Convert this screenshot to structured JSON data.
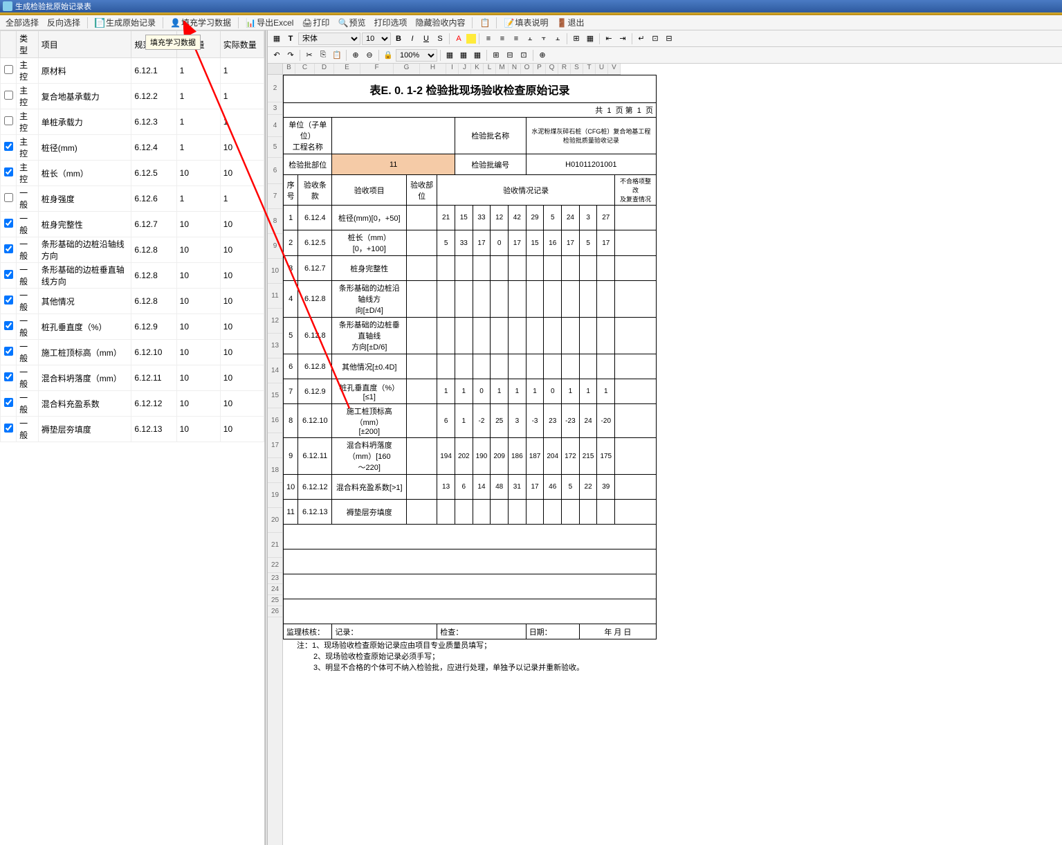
{
  "window": {
    "title": "生成检验批原始记录表"
  },
  "toolbar": {
    "select_all": "全部选择",
    "reverse_select": "反向选择",
    "gen_origin": "生成原始记录",
    "fill_learn": "填充学习数据",
    "export_excel": "导出Excel",
    "print": "打印",
    "preview": "预览",
    "print_opt": "打印选项",
    "hide_accept": "隐藏验收内容",
    "fill_desc": "填表说明",
    "exit": "退出"
  },
  "tooltip": "填充学习数据",
  "left_headers": {
    "checkbox": "",
    "type": "类型",
    "project": "项目",
    "spec": "规范条文",
    "decimals": "小数量",
    "actual": "实际数量"
  },
  "left_rows": [
    {
      "chk": false,
      "type": "主控",
      "project": "原材料",
      "spec": "6.12.1",
      "dec": "1",
      "act": "1"
    },
    {
      "chk": false,
      "type": "主控",
      "project": "复合地基承载力",
      "spec": "6.12.2",
      "dec": "1",
      "act": "1"
    },
    {
      "chk": false,
      "type": "主控",
      "project": "单桩承载力",
      "spec": "6.12.3",
      "dec": "1",
      "act": "1"
    },
    {
      "chk": true,
      "type": "主控",
      "project": "桩径(mm)",
      "spec": "6.12.4",
      "dec": "1",
      "act": "10"
    },
    {
      "chk": true,
      "type": "主控",
      "project": "桩长（mm）",
      "spec": "6.12.5",
      "dec": "10",
      "act": "10"
    },
    {
      "chk": false,
      "type": "一般",
      "project": "桩身强度",
      "spec": "6.12.6",
      "dec": "1",
      "act": "1"
    },
    {
      "chk": true,
      "type": "一般",
      "project": "桩身完整性",
      "spec": "6.12.7",
      "dec": "10",
      "act": "10"
    },
    {
      "chk": true,
      "type": "一般",
      "project": "条形基础的边桩沿轴线方向",
      "spec": "6.12.8",
      "dec": "10",
      "act": "10"
    },
    {
      "chk": true,
      "type": "一般",
      "project": "条形基础的边桩垂直轴线方向",
      "spec": "6.12.8",
      "dec": "10",
      "act": "10"
    },
    {
      "chk": true,
      "type": "一般",
      "project": "其他情况",
      "spec": "6.12.8",
      "dec": "10",
      "act": "10"
    },
    {
      "chk": true,
      "type": "一般",
      "project": "桩孔垂直度（%）",
      "spec": "6.12.9",
      "dec": "10",
      "act": "10"
    },
    {
      "chk": true,
      "type": "一般",
      "project": "施工桩顶标高（mm）",
      "spec": "6.12.10",
      "dec": "10",
      "act": "10"
    },
    {
      "chk": true,
      "type": "一般",
      "project": "混合料坍落度（mm）",
      "spec": "6.12.11",
      "dec": "10",
      "act": "10"
    },
    {
      "chk": true,
      "type": "一般",
      "project": "混合料充盈系数",
      "spec": "6.12.12",
      "dec": "10",
      "act": "10"
    },
    {
      "chk": true,
      "type": "一般",
      "project": "褥垫层夯填度",
      "spec": "6.12.13",
      "dec": "10",
      "act": "10"
    }
  ],
  "fmt": {
    "font": "宋体",
    "size": "10",
    "zoom": "100%"
  },
  "col_letters": [
    "B",
    "C",
    "D",
    "E",
    "F",
    "G",
    "H",
    "I",
    "J",
    "K",
    "L",
    "M",
    "N",
    "O",
    "P",
    "Q",
    "R",
    "S",
    "T",
    "U",
    "V"
  ],
  "doc": {
    "title": "表E. 0. 1-2    检验批现场验收检查原始记录",
    "page_prefix": "共",
    "page_num1": "1",
    "page_mid": "页 第",
    "page_num2": "1",
    "page_suffix": "页",
    "unit_label": "单位（子单位）\n工程名称",
    "batch_name_label": "检验批名称",
    "batch_name_value": "水泥粉煤灰碎石桩（CFG桩）复合地基工程检验批质量验收记录",
    "batch_part_label": "检验批部位",
    "batch_part_value": "11",
    "batch_no_label": "检验批编号",
    "batch_no_value": "H01011201001",
    "col_seq": "序号",
    "col_item": "验收条款",
    "col_project": "验收项目",
    "col_part": "验收部位",
    "col_record": "验收情况记录",
    "col_fix": "不合格项整改\n及复查情况",
    "rows": [
      {
        "n": "1",
        "item": "6.12.4",
        "proj": "桩径(mm)[0，+50]",
        "vals": [
          "21",
          "15",
          "33",
          "12",
          "42",
          "29",
          "5",
          "24",
          "3",
          "27"
        ]
      },
      {
        "n": "2",
        "item": "6.12.5",
        "proj": "桩长（mm）[0，+100]",
        "vals": [
          "5",
          "33",
          "17",
          "0",
          "17",
          "15",
          "16",
          "17",
          "5",
          "17"
        ]
      },
      {
        "n": "3",
        "item": "6.12.7",
        "proj": "桩身完整性",
        "vals": [
          "",
          "",
          "",
          "",
          "",
          "",
          "",
          "",
          "",
          ""
        ]
      },
      {
        "n": "4",
        "item": "6.12.8",
        "proj": "条形基础的边桩沿轴线方\n向[±D/4]",
        "vals": [
          "",
          "",
          "",
          "",
          "",
          "",
          "",
          "",
          "",
          ""
        ]
      },
      {
        "n": "5",
        "item": "6.12.8",
        "proj": "条形基础的边桩垂直轴线\n方向[±D/6]",
        "vals": [
          "",
          "",
          "",
          "",
          "",
          "",
          "",
          "",
          "",
          ""
        ]
      },
      {
        "n": "6",
        "item": "6.12.8",
        "proj": "其他情况[±0.4D]",
        "vals": [
          "",
          "",
          "",
          "",
          "",
          "",
          "",
          "",
          "",
          ""
        ]
      },
      {
        "n": "7",
        "item": "6.12.9",
        "proj": "桩孔垂直度（%）[≤1]",
        "vals": [
          "1",
          "1",
          "0",
          "1",
          "1",
          "1",
          "0",
          "1",
          "1",
          "1"
        ]
      },
      {
        "n": "8",
        "item": "6.12.10",
        "proj": "施工桩顶标高（mm）\n[±200]",
        "vals": [
          "6",
          "1",
          "-2",
          "25",
          "3",
          "-3",
          "23",
          "-23",
          "24",
          "-20"
        ]
      },
      {
        "n": "9",
        "item": "6.12.11",
        "proj": "混合料坍落度（mm）[160\n～220]",
        "vals": [
          "194",
          "202",
          "190",
          "209",
          "186",
          "187",
          "204",
          "172",
          "215",
          "175"
        ]
      },
      {
        "n": "10",
        "item": "6.12.12",
        "proj": "混合料充盈系数[>1]",
        "vals": [
          "13",
          "6",
          "14",
          "48",
          "31",
          "17",
          "46",
          "5",
          "22",
          "39"
        ]
      },
      {
        "n": "11",
        "item": "6.12.13",
        "proj": "褥垫层夯填度",
        "vals": [
          "",
          "",
          "",
          "",
          "",
          "",
          "",
          "",
          "",
          ""
        ]
      }
    ],
    "footer": {
      "supervise": "监理核核：",
      "record": "记录：",
      "check": "检查：",
      "date": "日期：",
      "ymd": "年  月  日"
    },
    "notes": [
      "注：1、现场验收检查原始记录应由项目专业质量员填写；",
      "2、现场验收检查原始记录必须手写；",
      "3、明显不合格的个体可不纳入检验批，应进行处理，单独予以记录并重新验收。"
    ]
  }
}
